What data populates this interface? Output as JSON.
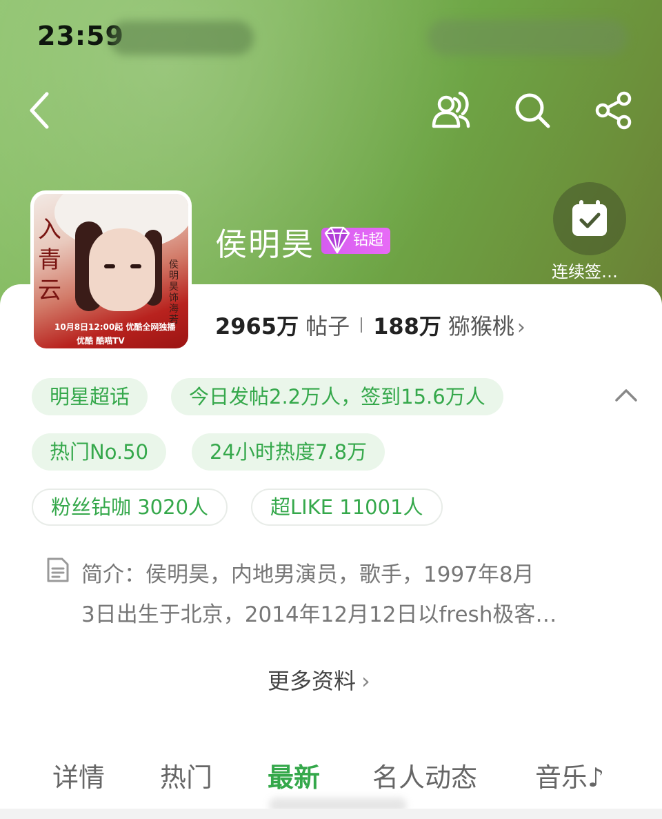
{
  "status_bar": {
    "time": "23:59"
  },
  "nav": {
    "back_icon": "chevron-left-icon",
    "people_icon": "people-icon",
    "search_icon": "search-icon",
    "share_icon": "share-icon"
  },
  "checkin": {
    "label": "连续签…",
    "icon": "calendar-check-icon"
  },
  "avatar": {
    "calligraphy": "入青云",
    "subtitle": "侯明昊 饰 海若",
    "date_text": "10月8日12:00起 优酷全网独播",
    "brand_text": "优酷 酷喵TV"
  },
  "topic": {
    "name": "侯明昊",
    "badge": "钻超"
  },
  "stats": {
    "posts_count": "2965万",
    "posts_label": "帖子",
    "fans_count": "188万",
    "fans_label": "猕猴桃"
  },
  "chips": {
    "category": "明星超话",
    "daily": "今日发帖2.2万人，签到15.6万人",
    "rank": "热门No.50",
    "heat": "24小时热度7.8万",
    "diamond_fans": "粉丝钻咖 3020人",
    "super_like": "超LIKE 11001人"
  },
  "intro": {
    "line1": "简介：侯明昊，内地男演员，歌手，1997年8月",
    "line2": "3日出生于北京，2014年12月12日以fresh极客…"
  },
  "more_link": "更多资料",
  "tabs": [
    "详情",
    "热门",
    "最新",
    "名人动态",
    "音乐♪"
  ],
  "active_tab": "最新",
  "colors": {
    "accent_green": "#35a84b",
    "chip_bg": "#eaf6ea",
    "badge_purple": "#d65cf0"
  }
}
